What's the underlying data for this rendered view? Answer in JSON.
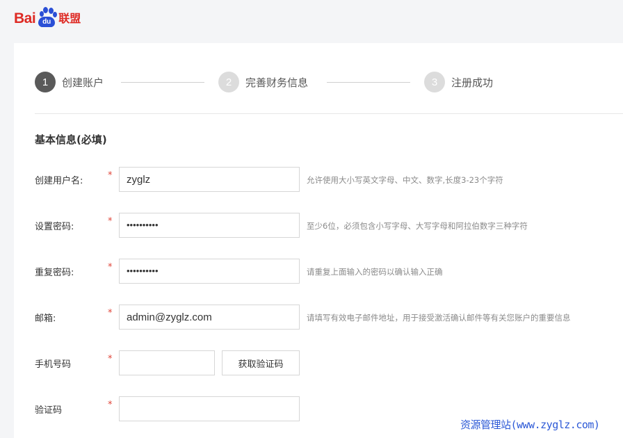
{
  "logo": {
    "text_left": "Bai",
    "text_paw": "du",
    "text_right": "联盟"
  },
  "steps": [
    {
      "number": "1",
      "label": "创建账户",
      "active": true
    },
    {
      "number": "2",
      "label": "完善财务信息",
      "active": false
    },
    {
      "number": "3",
      "label": "注册成功",
      "active": false
    }
  ],
  "section_title": "基本信息(必填)",
  "required_mark": "*",
  "form": {
    "username": {
      "label": "创建用户名:",
      "value": "zyglz",
      "hint": "允许使用大小写英文字母、中文、数字,长度3-23个字符"
    },
    "password": {
      "label": "设置密码:",
      "value": "••••••••••",
      "hint": "至少6位，必须包含小写字母、大写字母和阿拉伯数字三种字符"
    },
    "password_repeat": {
      "label": "重复密码:",
      "value": "••••••••••",
      "hint": "请重复上面输入的密码以确认输入正确"
    },
    "email": {
      "label": "邮箱:",
      "value": "admin@zyglz.com",
      "hint": "请填写有效电子邮件地址，用于接受激活确认邮件等有关您账户的重要信息"
    },
    "phone": {
      "label": "手机号码",
      "value": "",
      "button": "获取验证码"
    },
    "code": {
      "label": "验证码",
      "value": ""
    }
  },
  "watermark": "资源管理站(www.zyglz.com)",
  "colors": {
    "brand_red": "#de2a24",
    "brand_blue": "#2a4fd6",
    "required": "#e0463a",
    "active_step": "#5a5a5a"
  }
}
